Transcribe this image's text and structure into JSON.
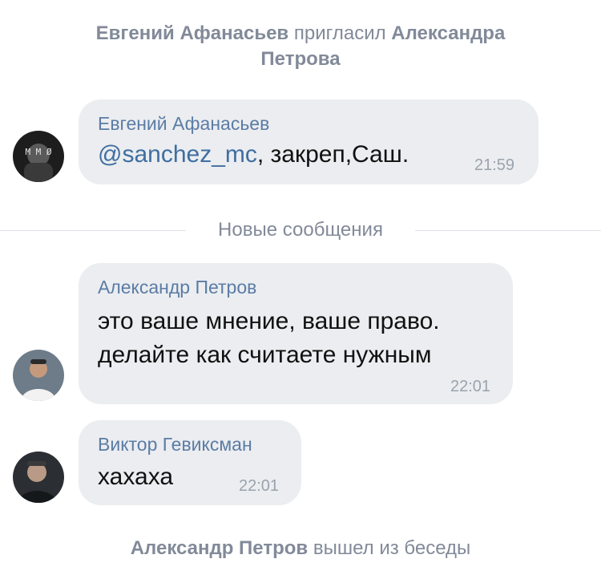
{
  "service_top": {
    "actor": "Евгений Афанасьев",
    "action": "пригласил",
    "target": "Александра Петрова"
  },
  "divider": {
    "label": "Новые сообщения"
  },
  "messages": [
    {
      "author": "Евгений Афанасьев",
      "mention": "@sanchez_mc",
      "text": ",  закреп,Саш.",
      "time": "21:59",
      "avatar": "avatar-photo"
    },
    {
      "author": "Александр Петров",
      "lines": [
        "это ваше мнение, ваше право.",
        "делайте как считаете нужным"
      ],
      "time": "22:01",
      "avatar": "avatar-photo"
    },
    {
      "author": "Виктор Гевиксман",
      "text": "хахаха",
      "time": "22:01",
      "avatar": "avatar-photo"
    }
  ],
  "service_bottom": {
    "actor": "Александр Петров",
    "action": "вышел из беседы"
  },
  "colors": {
    "bubble": "#ebedf0",
    "author": "#5b7ca5",
    "service_text": "#828a99",
    "mention": "#3f6ea1"
  }
}
